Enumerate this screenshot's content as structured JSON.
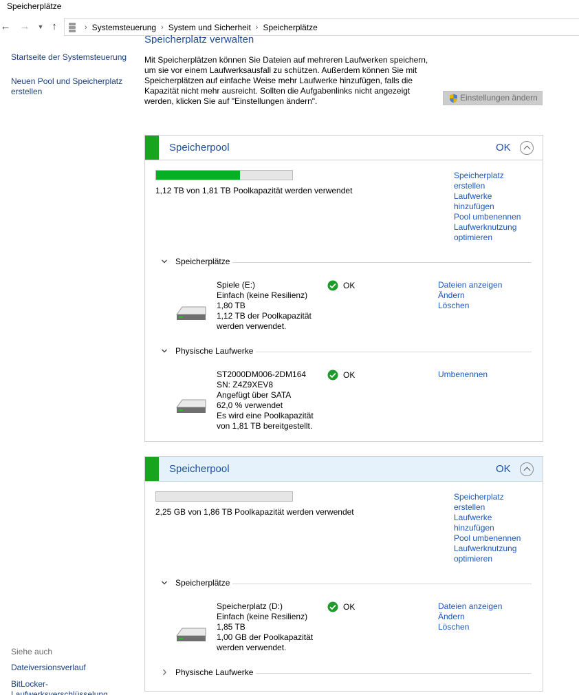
{
  "window": {
    "title": "Speicherplätze"
  },
  "navigation": {
    "breadcrumbs": [
      "Systemsteuerung",
      "System und Sicherheit",
      "Speicherplätze"
    ]
  },
  "sidebar": {
    "home_link": "Startseite der Systemsteuerung",
    "new_pool_link": "Neuen Pool und Speicherplatz erstellen",
    "see_also_label": "Siehe auch",
    "see_also_links": [
      "Dateiversionsverlauf",
      "BitLocker-Laufwerksverschlüsselung"
    ]
  },
  "main": {
    "title": "Speicherplatz verwalten",
    "intro": "Mit Speicherplätzen können Sie Dateien auf mehreren Laufwerken speichern, um sie vor einem Laufwerksausfall zu schützen. Außerdem können Sie mit Speicherplätzen auf einfache Weise mehr Laufwerke hinzufügen, falls die Kapazität nicht mehr ausreicht. Sollten die Aufgabenlinks nicht angezeigt werden, klicken Sie auf \"Einstellungen ändern\".",
    "settings_button": "Einstellungen ändern"
  },
  "pools": [
    {
      "name": "Speicherpool",
      "status": "OK",
      "usage_fraction": 0.618,
      "usage_text": "1,12 TB von 1,81 TB Poolkapazität werden verwendet",
      "actions": [
        "Speicherplatz erstellen",
        "Laufwerke hinzufügen",
        "Pool umbenennen",
        "Laufwerknutzung optimieren"
      ],
      "spaces_section": "Speicherplätze",
      "spaces": [
        {
          "lines": [
            "Spiele (E:)",
            "Einfach (keine Resilienz)",
            "1,80 TB",
            "1,12 TB der Poolkapazität",
            "werden verwendet."
          ],
          "status": "OK",
          "actions": [
            "Dateien anzeigen",
            "Ändern",
            "Löschen"
          ]
        }
      ],
      "drives_section": "Physische Laufwerke",
      "drives": [
        {
          "lines": [
            "ST2000DM006-2DM164",
            "SN: Z4Z9XEV8",
            "Angefügt über SATA",
            "62,0 % verwendet",
            "Es wird eine Poolkapazität",
            "von 1,81 TB bereitgestellt."
          ],
          "status": "OK",
          "actions": [
            "Umbenennen"
          ]
        }
      ]
    },
    {
      "name": "Speicherpool",
      "status": "OK",
      "usage_fraction": 0.0,
      "usage_text": "2,25 GB von 1,86 TB Poolkapazität werden verwendet",
      "actions": [
        "Speicherplatz erstellen",
        "Laufwerke hinzufügen",
        "Pool umbenennen",
        "Laufwerknutzung optimieren"
      ],
      "spaces_section": "Speicherplätze",
      "spaces": [
        {
          "lines": [
            "Speicherplatz (D:)",
            "Einfach (keine Resilienz)",
            "1,85 TB",
            "1,00 GB der Poolkapazität",
            "werden verwendet."
          ],
          "status": "OK",
          "actions": [
            "Dateien anzeigen",
            "Ändern",
            "Löschen"
          ]
        }
      ],
      "drives_section": "Physische Laufwerke"
    }
  ]
}
